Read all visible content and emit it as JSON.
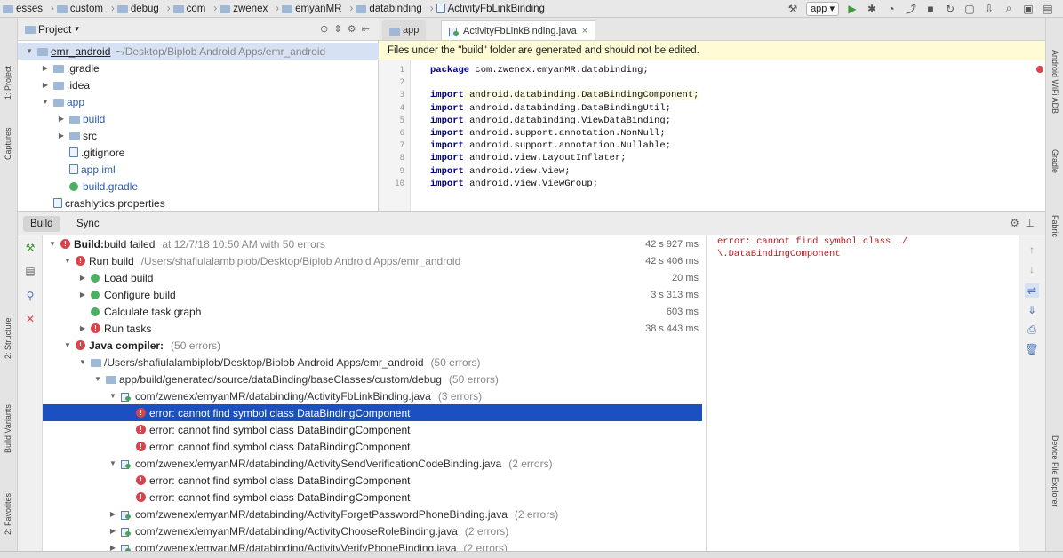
{
  "nav": {
    "crumbs": [
      "esses",
      "custom",
      "debug",
      "com",
      "zwenex",
      "emyanMR",
      "databinding",
      "ActivityFbLinkBinding"
    ],
    "run_config": "app"
  },
  "left_strip": {
    "tabs": [
      "1: Project",
      "Captures",
      "2: Structure",
      "Build Variants",
      "2: Favorites"
    ]
  },
  "right_strip": {
    "tabs": [
      "Android WiFi ADB",
      "Gradle",
      "Fabric",
      "Device File Explorer"
    ]
  },
  "project": {
    "view_label": "Project",
    "root": {
      "name": "emr_android",
      "path": "~/Desktop/Biplob Android Apps/emr_android"
    },
    "items": [
      {
        "label": ".gradle"
      },
      {
        "label": ".idea"
      },
      {
        "label": "app"
      },
      {
        "label": "build"
      },
      {
        "label": "src"
      },
      {
        "label": ".gitignore"
      },
      {
        "label": "app.iml"
      },
      {
        "label": "build.gradle"
      },
      {
        "label": "crashlytics.properties"
      }
    ]
  },
  "editor": {
    "tabs": [
      "app",
      "ActivityFbLinkBinding.java"
    ],
    "banner": "Files under the \"build\" folder are generated and should not be edited.",
    "lines": [
      {
        "n": "1",
        "kw": "package",
        "rest": " com.zwenex.emyanMR.databinding;"
      },
      {
        "n": "2",
        "kw": "",
        "rest": ""
      },
      {
        "n": "3",
        "kw": "import",
        "rest": " android.databinding.DataBindingComponent;"
      },
      {
        "n": "4",
        "kw": "import",
        "rest": " android.databinding.DataBindingUtil;"
      },
      {
        "n": "5",
        "kw": "import",
        "rest": " android.databinding.ViewDataBinding;"
      },
      {
        "n": "6",
        "kw": "import",
        "rest": " android.support.annotation.NonNull;"
      },
      {
        "n": "7",
        "kw": "import",
        "rest": " android.support.annotation.Nullable;"
      },
      {
        "n": "8",
        "kw": "import",
        "rest": " android.view.LayoutInflater;"
      },
      {
        "n": "9",
        "kw": "import",
        "rest": " android.view.View;"
      },
      {
        "n": "10",
        "kw": "import",
        "rest": " android.view.ViewGroup;"
      }
    ]
  },
  "build": {
    "tabs": [
      "Build",
      "Sync"
    ],
    "rows": [
      {
        "indent": 0,
        "arrow": "▼",
        "icon": "error",
        "bold": "Build:",
        "text": " build failed",
        "extra": "at 12/7/18 10:50 AM   with 50 errors",
        "time": "42 s 927 ms"
      },
      {
        "indent": 1,
        "arrow": "▼",
        "icon": "error",
        "bold": "",
        "text": "Run build",
        "extra": "/Users/shafiulalambiplob/Desktop/Biplob Android Apps/emr_android",
        "time": "42 s 406 ms"
      },
      {
        "indent": 2,
        "arrow": "▶",
        "icon": "ok",
        "bold": "",
        "text": "Load build",
        "extra": "",
        "time": "20 ms"
      },
      {
        "indent": 2,
        "arrow": "▶",
        "icon": "ok",
        "bold": "",
        "text": "Configure build",
        "extra": "",
        "time": "3 s 313 ms"
      },
      {
        "indent": 2,
        "arrow": "",
        "icon": "ok",
        "bold": "",
        "text": "Calculate task graph",
        "extra": "",
        "time": "603 ms"
      },
      {
        "indent": 2,
        "arrow": "▶",
        "icon": "error",
        "bold": "",
        "text": "Run tasks",
        "extra": "",
        "time": "38 s 443 ms"
      },
      {
        "indent": 1,
        "arrow": "▼",
        "icon": "error",
        "bold": "Java compiler:",
        "text": "",
        "extra": "(50 errors)",
        "time": ""
      },
      {
        "indent": 2,
        "arrow": "▼",
        "icon": "folder",
        "bold": "",
        "text": "/Users/shafiulalambiplob/Desktop/Biplob Android Apps/emr_android",
        "extra": "(50 errors)",
        "time": ""
      },
      {
        "indent": 3,
        "arrow": "▼",
        "icon": "folder",
        "bold": "",
        "text": "app/build/generated/source/dataBinding/baseClasses/custom/debug",
        "extra": "(50 errors)",
        "time": ""
      },
      {
        "indent": 4,
        "arrow": "▼",
        "icon": "java",
        "bold": "",
        "text": "com/zwenex/emyanMR/databinding/ActivityFbLinkBinding.java",
        "extra": "(3 errors)",
        "time": ""
      },
      {
        "indent": 5,
        "arrow": "",
        "icon": "error",
        "bold": "",
        "text": "error: cannot find symbol class DataBindingComponent",
        "extra": "",
        "time": "",
        "selected": true
      },
      {
        "indent": 5,
        "arrow": "",
        "icon": "error",
        "bold": "",
        "text": "error: cannot find symbol class DataBindingComponent",
        "extra": "",
        "time": ""
      },
      {
        "indent": 5,
        "arrow": "",
        "icon": "error",
        "bold": "",
        "text": "error: cannot find symbol class DataBindingComponent",
        "extra": "",
        "time": ""
      },
      {
        "indent": 4,
        "arrow": "▼",
        "icon": "java",
        "bold": "",
        "text": "com/zwenex/emyanMR/databinding/ActivitySendVerificationCodeBinding.java",
        "extra": "(2 errors)",
        "time": ""
      },
      {
        "indent": 5,
        "arrow": "",
        "icon": "error",
        "bold": "",
        "text": "error: cannot find symbol class DataBindingComponent",
        "extra": "",
        "time": ""
      },
      {
        "indent": 5,
        "arrow": "",
        "icon": "error",
        "bold": "",
        "text": "error: cannot find symbol class DataBindingComponent",
        "extra": "",
        "time": ""
      },
      {
        "indent": 4,
        "arrow": "▶",
        "icon": "java",
        "bold": "",
        "text": "com/zwenex/emyanMR/databinding/ActivityForgetPasswordPhoneBinding.java",
        "extra": "(2 errors)",
        "time": ""
      },
      {
        "indent": 4,
        "arrow": "▶",
        "icon": "java",
        "bold": "",
        "text": "com/zwenex/emyanMR/databinding/ActivityChooseRoleBinding.java",
        "extra": "(2 errors)",
        "time": ""
      },
      {
        "indent": 4,
        "arrow": "▶",
        "icon": "java",
        "bold": "",
        "text": "com/zwenex/emyanMR/databinding/ActivityVerifyPhoneBinding.java",
        "extra": "(2 errors)",
        "time": ""
      }
    ],
    "detail": "error: cannot find symbol class ./\n\\.DataBindingComponent"
  },
  "colors": {
    "selection": "#1a50c0",
    "error": "#d9434b",
    "ok": "#4caf62",
    "banner": "#fffbd4"
  }
}
